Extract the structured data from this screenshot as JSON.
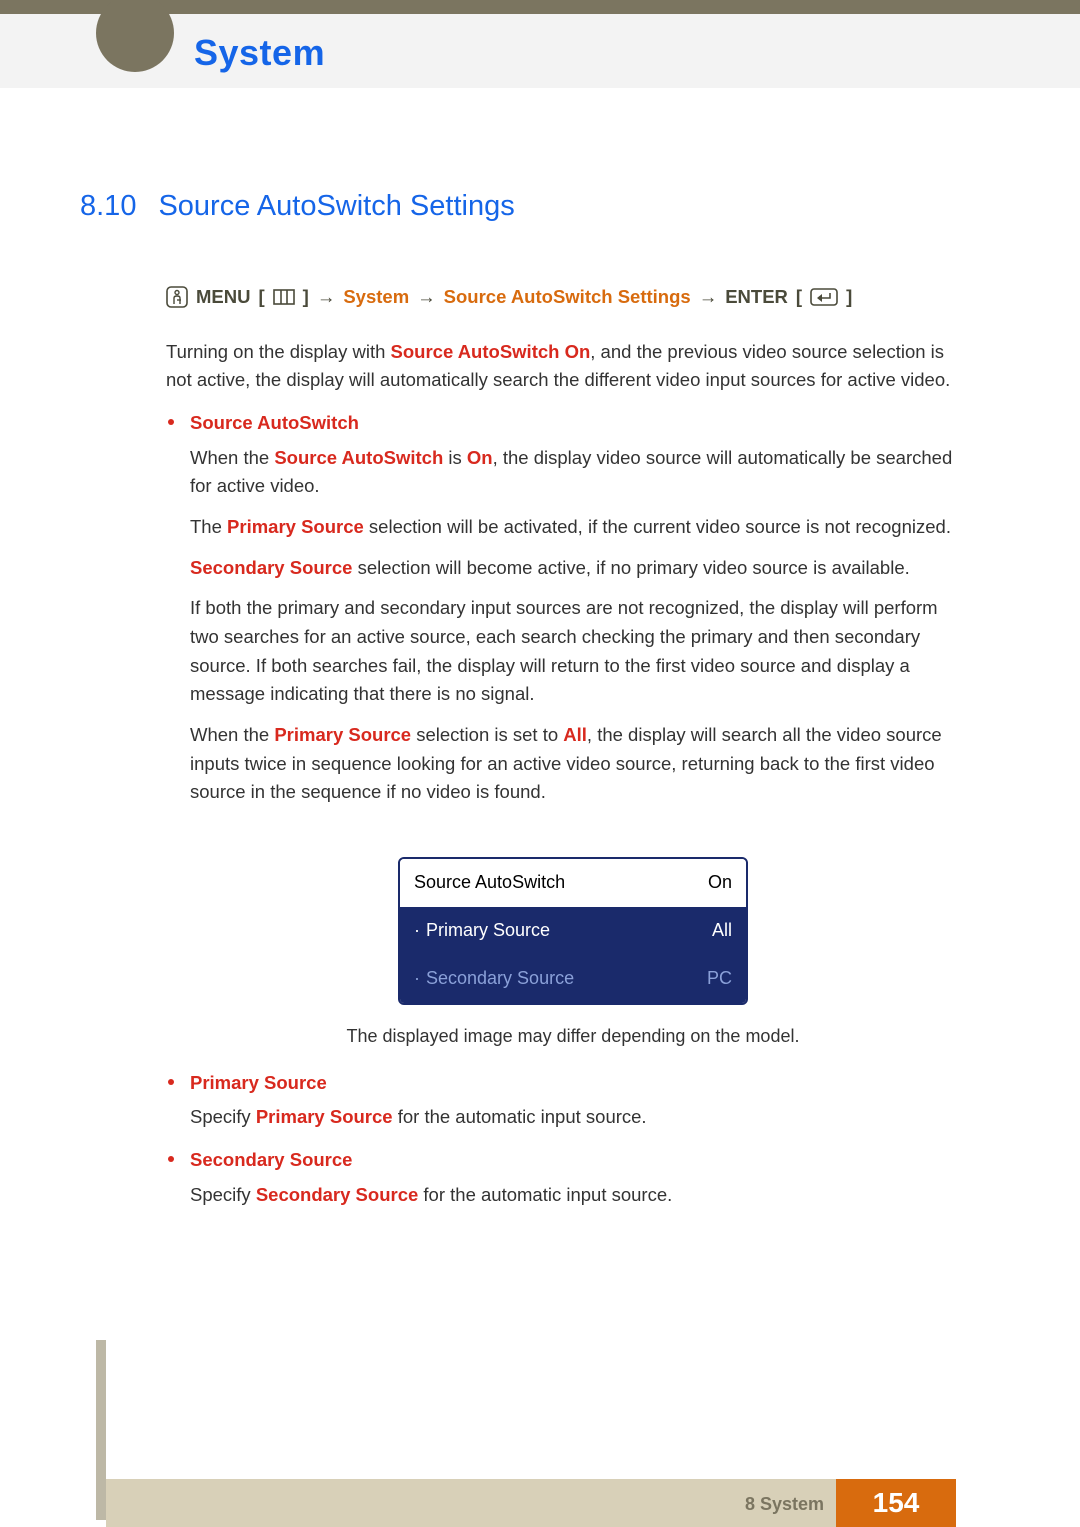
{
  "header": {
    "chapter_title": "System"
  },
  "section": {
    "number": "8.10",
    "title": "Source AutoSwitch Settings"
  },
  "nav": {
    "menu": "MENU",
    "path1": "System",
    "path2": "Source AutoSwitch Settings",
    "enter": "ENTER",
    "arrow": "→"
  },
  "intro": {
    "pre": "Turning on the display with ",
    "bold": "Source AutoSwitch On",
    "post": ", and the previous video source selection is not active, the display will automatically search the different video input sources for active video."
  },
  "items": {
    "source_autoswitch": {
      "title": "Source AutoSwitch",
      "p1_a": "When the ",
      "p1_b": "Source AutoSwitch",
      "p1_c": " is ",
      "p1_d": "On",
      "p1_e": ", the display video source will automatically be searched for active video.",
      "p2_a": "The ",
      "p2_b": "Primary Source",
      "p2_c": " selection will be activated, if the current video source is not recognized.",
      "p3_a": "Secondary Source",
      "p3_b": " selection will become active, if no primary video source is available.",
      "p4": "If both the primary and secondary input sources are not recognized, the display will perform two searches for an active source, each search checking the primary and then secondary source. If both searches fail, the display will return to the first video source and display a message indicating that there is no signal.",
      "p5_a": "When the ",
      "p5_b": "Primary Source",
      "p5_c": " selection is set to ",
      "p5_d": "All",
      "p5_e": ", the display will search all the video source inputs twice in sequence looking for an active video source, returning back to the first video source in the sequence if no video is found."
    },
    "primary_source": {
      "title": "Primary Source",
      "p_a": "Specify ",
      "p_b": "Primary Source",
      "p_c": " for the automatic input source."
    },
    "secondary_source": {
      "title": "Secondary Source",
      "p_a": "Specify ",
      "p_b": "Secondary Source",
      "p_c": " for the automatic input source."
    }
  },
  "osd": {
    "row1_label": "Source AutoSwitch",
    "row1_value": "On",
    "row2_label": "Primary Source",
    "row2_value": "All",
    "row3_label": "Secondary Source",
    "row3_value": "PC",
    "caption": "The displayed image may differ depending on the model."
  },
  "footer": {
    "chapter": "8 System",
    "page": "154"
  }
}
